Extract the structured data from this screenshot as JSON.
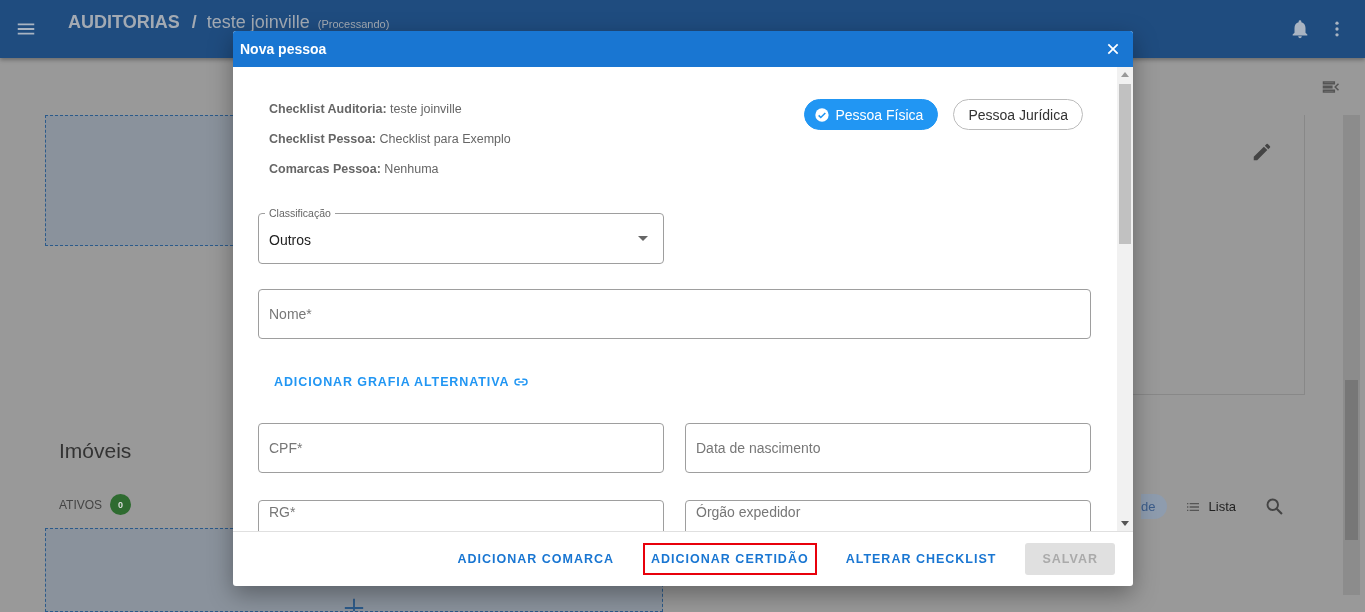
{
  "app_bar": {
    "title": "AUDITORIAS",
    "separator": "/",
    "subtitle": "teste joinville",
    "status": "(Processando)"
  },
  "background": {
    "section_title": "Imóveis",
    "active_label": "ATIVOS",
    "active_count": "0",
    "view_chip": "de",
    "view_option": "Lista"
  },
  "dialog": {
    "title": "Nova pessoa",
    "info": [
      {
        "label": "Checklist Auditoria:",
        "value": "teste joinville"
      },
      {
        "label": "Checklist Pessoa:",
        "value": "Checklist para Exemplo"
      },
      {
        "label": "Comarcas Pessoa:",
        "value": "Nenhuma"
      }
    ],
    "person_types": [
      {
        "label": "Pessoa Física",
        "selected": true
      },
      {
        "label": "Pessoa Jurídica",
        "selected": false
      }
    ],
    "classification": {
      "label": "Classificação",
      "value": "Outros"
    },
    "name_field": {
      "placeholder": "Nome*"
    },
    "link": "ADICIONAR GRAFIA ALTERNATIVA",
    "field_rows": [
      [
        {
          "placeholder": "CPF*"
        },
        {
          "placeholder": "Data de nascimento"
        }
      ],
      [
        {
          "placeholder": "RG*"
        },
        {
          "placeholder": "Órgão expedidor"
        }
      ]
    ],
    "actions": [
      {
        "label": "ADICIONAR COMARCA",
        "disabled": false,
        "highlighted": false
      },
      {
        "label": "ADICIONAR CERTIDÃO",
        "disabled": false,
        "highlighted": true
      },
      {
        "label": "ALTERAR CHECKLIST",
        "disabled": false,
        "highlighted": false
      },
      {
        "label": "SALVAR",
        "disabled": true,
        "highlighted": false
      }
    ]
  }
}
